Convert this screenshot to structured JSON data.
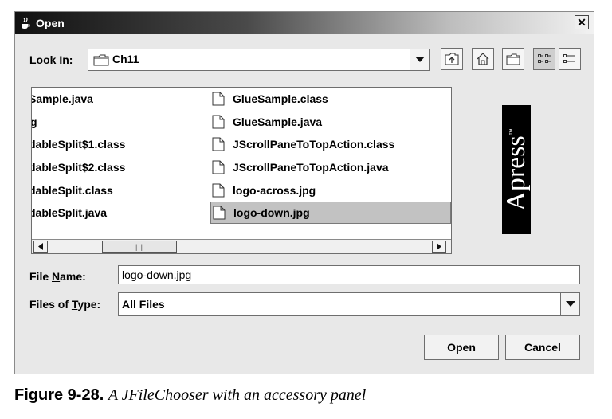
{
  "window": {
    "title": "Open",
    "close_glyph": "✕"
  },
  "look_in": {
    "label_prefix": "Look ",
    "label_mnemonic": "I",
    "label_suffix": "n:",
    "value": "Ch11",
    "icon": "folder-icon"
  },
  "toolbar": [
    {
      "name": "up-one-level",
      "icon": "up-folder-icon"
    },
    {
      "name": "home",
      "icon": "home-icon"
    },
    {
      "name": "new-folder",
      "icon": "new-folder-icon"
    },
    {
      "name": "list-view",
      "icon": "list-view-icon",
      "active": true
    },
    {
      "name": "details-view",
      "icon": "details-view-icon",
      "active": false
    }
  ],
  "files": {
    "column1": [
      {
        "name": "Sample.java",
        "visible_text": "Sample.java"
      },
      {
        "name": "g",
        "visible_text": "g"
      },
      {
        "name": "dableSplit$1.class",
        "visible_text": "dableSplit$1.class"
      },
      {
        "name": "dableSplit$2.class",
        "visible_text": "dableSplit$2.class"
      },
      {
        "name": "dableSplit.class",
        "visible_text": "dableSplit.class"
      },
      {
        "name": "dableSplit.java",
        "visible_text": "dableSplit.java"
      }
    ],
    "column2": [
      {
        "name": "GlueSample.class",
        "selected": false
      },
      {
        "name": "GlueSample.java",
        "selected": false
      },
      {
        "name": "JScrollPaneToTopAction.class",
        "selected": false
      },
      {
        "name": "JScrollPaneToTopAction.java",
        "selected": false
      },
      {
        "name": "logo-across.jpg",
        "selected": false
      },
      {
        "name": "logo-down.jpg",
        "selected": true
      }
    ]
  },
  "accessory": {
    "logo_text": "Apress",
    "trademark": "™"
  },
  "file_name": {
    "label_prefix": "File ",
    "label_mnemonic": "N",
    "label_suffix": "ame:",
    "value": "logo-down.jpg"
  },
  "file_type": {
    "label_prefix": "Files of ",
    "label_mnemonic": "T",
    "label_suffix": "ype:",
    "value": "All Files"
  },
  "buttons": {
    "open": "Open",
    "cancel": "Cancel"
  },
  "caption": {
    "figure": "Figure 9-28.",
    "text": "A JFileChooser with an accessory panel"
  }
}
